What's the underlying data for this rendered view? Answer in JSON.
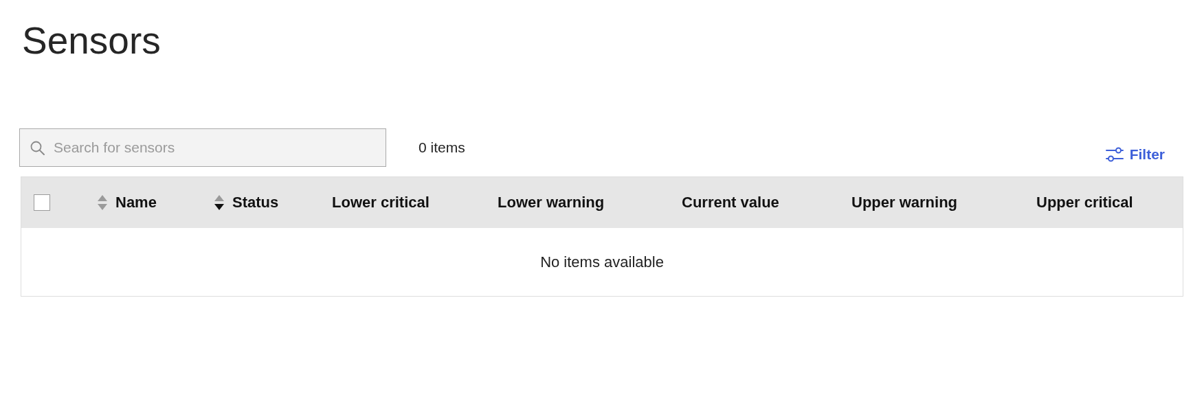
{
  "page": {
    "title": "Sensors"
  },
  "toolbar": {
    "search": {
      "placeholder": "Search for sensors"
    },
    "item_count": "0 items",
    "filter_button": {
      "label": "Filter"
    }
  },
  "table": {
    "select_all": {
      "checked": false
    },
    "columns": [
      {
        "label": "Name",
        "sortable": true,
        "sort_ascending": false,
        "sort_descending": false
      },
      {
        "label": "Status",
        "sortable": true,
        "sort_ascending": false,
        "sort_descending": true
      },
      {
        "label": "Lower critical",
        "sortable": false
      },
      {
        "label": "Lower warning",
        "sortable": false
      },
      {
        "label": "Current value",
        "sortable": false
      },
      {
        "label": "Upper warning",
        "sortable": false
      },
      {
        "label": "Upper critical",
        "sortable": false
      }
    ],
    "empty_message": "No items available"
  }
}
